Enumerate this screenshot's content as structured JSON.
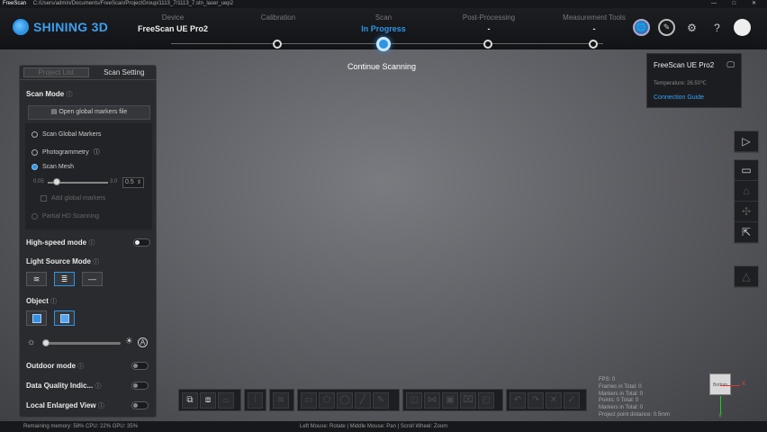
{
  "window": {
    "app": "FreeScan",
    "path": "C:/Users/admin/Documents/FreeScan/ProjectGroup/1113_7/1113_7.stn_laser_uep2",
    "controls": "— □ ✕"
  },
  "brand": {
    "name": "SHINING 3D",
    "accent": "#2d95e8"
  },
  "steps": [
    {
      "label": "Device",
      "sub": "FreeScan UE Pro2"
    },
    {
      "label": "Calibration",
      "sub": ""
    },
    {
      "label": "Scan",
      "sub": "In Progress"
    },
    {
      "label": "Post-Processing",
      "sub": "-"
    },
    {
      "label": "Measurement Tools",
      "sub": "-"
    }
  ],
  "header_icons": [
    "globe-icon",
    "compass-icon",
    "gear-icon",
    "help-icon",
    "user-icon"
  ],
  "continue_label": "Continue Scanning",
  "panel": {
    "tabs": [
      "Project List",
      "Scan Setting"
    ],
    "scan_mode_label": "Scan Mode",
    "open_markers": "Open global markers file",
    "modes": [
      "Scan Global Markers",
      "Photogrammetry",
      "Scan Mesh"
    ],
    "res_min": "0.05",
    "res_max": "3.0",
    "res_value": "0.5",
    "res_value_num": 0.5,
    "add_markers": "Add global markers",
    "partial_hd": "Partial HD Scanning",
    "high_speed": "High-speed mode",
    "light_source": "Light Source Mode",
    "object": "Object",
    "outdoor": "Outdoor mode",
    "data_quality": "Data Quality Indic...",
    "local_enlarged": "Local Enlarged View"
  },
  "device_card": {
    "name": "FreeScan UE Pro2",
    "temperature": "Temperature: 26.50℃",
    "link": "Connection Guide"
  },
  "stats": [
    "FPS: 0",
    "Frames in Total: 0",
    "Markers in Total: 0",
    "Points: 0 Total: 0",
    "Markers in Total: 0",
    "Project point distance: 0.5mm"
  ],
  "axis": {
    "box": "Bottom",
    "x": "X",
    "y": "Y"
  },
  "status": {
    "left": "Remaining memory: 58% CPU: 22% GPU: 35%",
    "center": "Left Mouse: Rotate | Middle Mouse: Pan | Scroll Wheel: Zoom"
  }
}
